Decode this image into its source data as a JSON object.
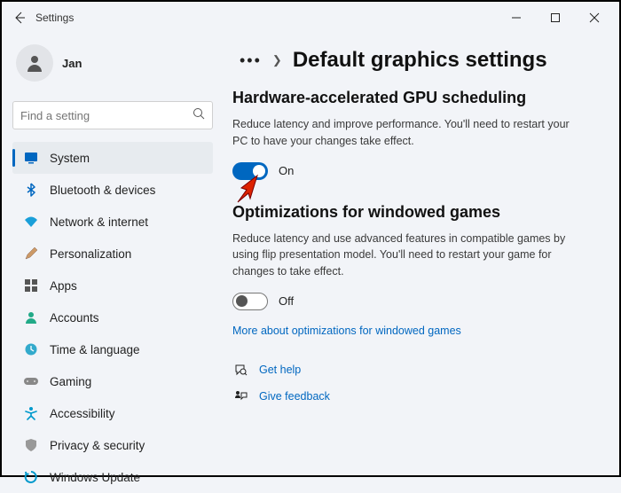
{
  "titlebar": {
    "title": "Settings"
  },
  "profile": {
    "name": "Jan"
  },
  "search": {
    "placeholder": "Find a setting"
  },
  "nav": {
    "items": [
      {
        "label": "System"
      },
      {
        "label": "Bluetooth & devices"
      },
      {
        "label": "Network & internet"
      },
      {
        "label": "Personalization"
      },
      {
        "label": "Apps"
      },
      {
        "label": "Accounts"
      },
      {
        "label": "Time & language"
      },
      {
        "label": "Gaming"
      },
      {
        "label": "Accessibility"
      },
      {
        "label": "Privacy & security"
      },
      {
        "label": "Windows Update"
      }
    ]
  },
  "page": {
    "title": "Default graphics settings",
    "sec1": {
      "heading": "Hardware-accelerated GPU scheduling",
      "desc": "Reduce latency and improve performance. You'll need to restart your PC to have your changes take effect.",
      "toggle_label": "On"
    },
    "sec2": {
      "heading": "Optimizations for windowed games",
      "desc": "Reduce latency and use advanced features in compatible games by using flip presentation model. You'll need to restart your game for changes to take effect.",
      "toggle_label": "Off",
      "link": "More about optimizations for windowed games"
    },
    "help": {
      "get_help": "Get help",
      "feedback": "Give feedback"
    }
  }
}
